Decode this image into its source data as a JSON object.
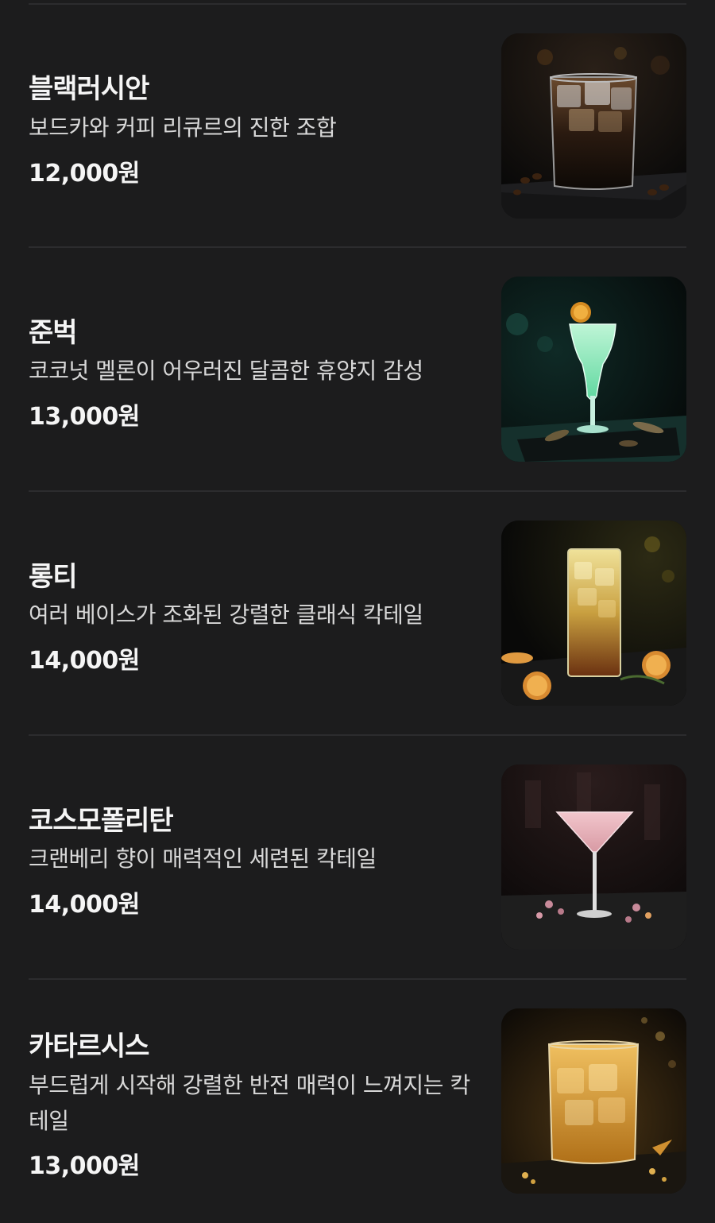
{
  "menu": {
    "items": [
      {
        "name": "블랙러시안",
        "description": "보드카와 커피 리큐르의 진한 조합",
        "price": "12,000원",
        "image_icon": "black-russian-cocktail-icon"
      },
      {
        "name": "준벅",
        "description": "코코넛 멜론이 어우러진 달콤한 휴양지 감성",
        "price": "13,000원",
        "image_icon": "june-bug-cocktail-icon"
      },
      {
        "name": "롱티",
        "description": "여러 베이스가 조화된 강렬한 클래식 칵테일",
        "price": "14,000원",
        "image_icon": "long-island-iced-tea-icon"
      },
      {
        "name": "코스모폴리탄",
        "description": "크랜베리 향이 매력적인 세련된 칵테일",
        "price": "14,000원",
        "image_icon": "cosmopolitan-cocktail-icon"
      },
      {
        "name": "카타르시스",
        "description": "부드럽게 시작해 강렬한 반전 매력이 느껴지는 칵테일",
        "price": "13,000원",
        "image_icon": "catharsis-cocktail-icon"
      }
    ]
  },
  "colors": {
    "background": "#1c1c1d",
    "divider": "#2c2c2e",
    "text_primary": "#f5f5f5",
    "text_secondary": "#d8d8d8"
  }
}
